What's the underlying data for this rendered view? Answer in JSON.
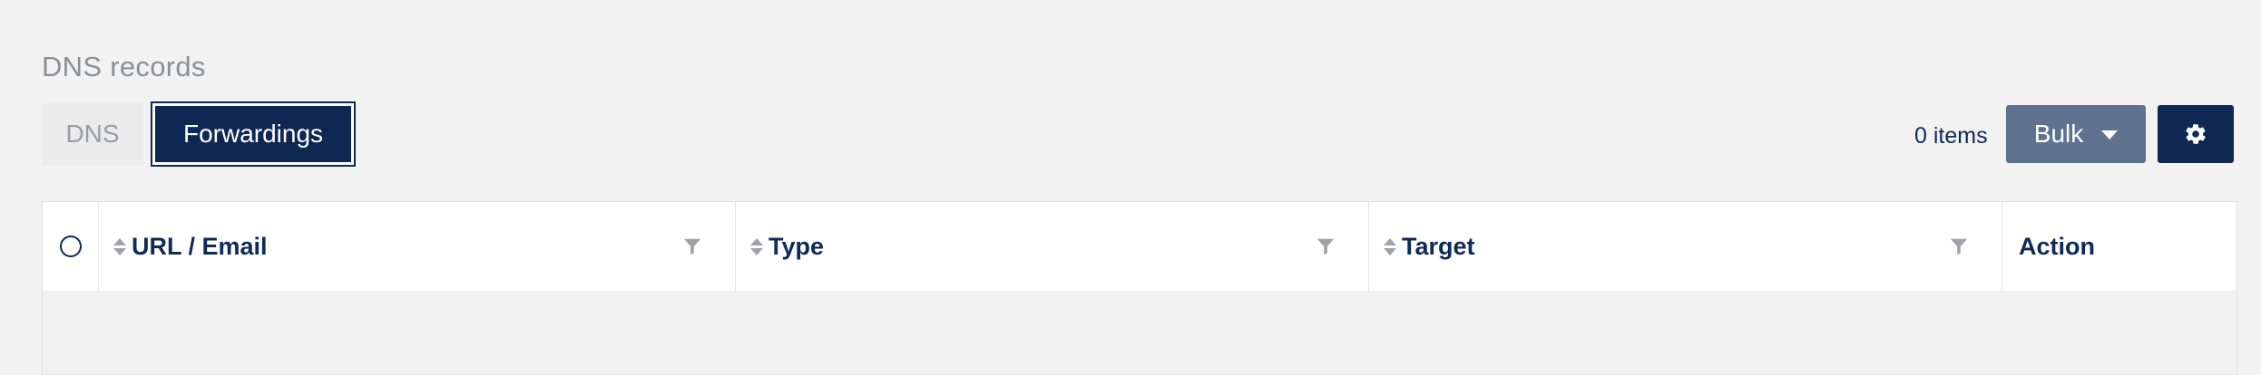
{
  "section": {
    "title": "DNS records"
  },
  "tabs": [
    {
      "label": "DNS",
      "active": false
    },
    {
      "label": "Forwardings",
      "active": true
    }
  ],
  "toolbar": {
    "items_count": "0 items",
    "bulk_label": "Bulk",
    "settings_icon": "gear-icon"
  },
  "table": {
    "columns": [
      {
        "label": "URL / Email",
        "sortable": true,
        "filterable": true
      },
      {
        "label": "Type",
        "sortable": true,
        "filterable": true
      },
      {
        "label": "Target",
        "sortable": true,
        "filterable": true
      },
      {
        "label": "Action",
        "sortable": false,
        "filterable": false
      }
    ],
    "rows": []
  },
  "colors": {
    "primary": "#0f2753",
    "bulk": "#5f7290",
    "background": "#f2f2f2"
  }
}
